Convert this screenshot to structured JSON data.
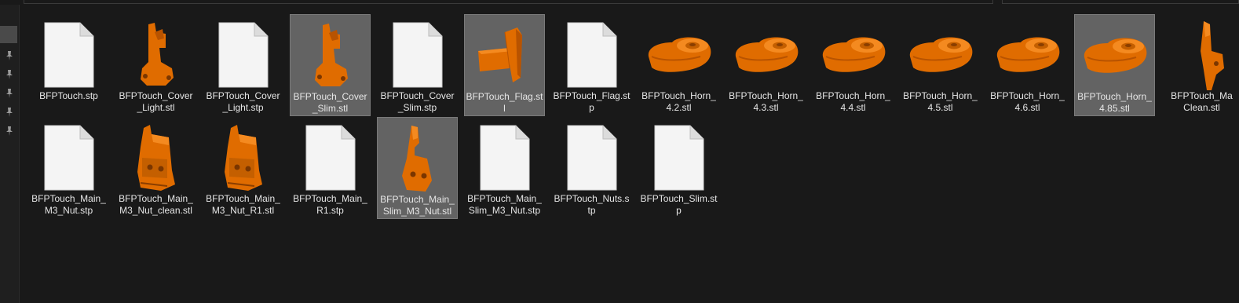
{
  "files": [
    {
      "name": "BFPTouch.stp",
      "label": "BFPTouch.stp",
      "type": "document",
      "selected": false,
      "icon": "document-icon"
    },
    {
      "name": "BFPTouch_Cover_Light.stl",
      "label": "BFPTouch_Cover\n_Light.stl",
      "type": "model-cover",
      "selected": false,
      "icon": "cover-model-thumbnail"
    },
    {
      "name": "BFPTouch_Cover_Light.stp",
      "label": "BFPTouch_Cover\n_Light.stp",
      "type": "document",
      "selected": false,
      "icon": "document-icon"
    },
    {
      "name": "BFPTouch_Cover_Slim.stl",
      "label": "BFPTouch_Cover\n_Slim.stl",
      "type": "model-cover",
      "selected": true,
      "icon": "cover-model-thumbnail"
    },
    {
      "name": "BFPTouch_Cover_Slim.stp",
      "label": "BFPTouch_Cover\n_Slim.stp",
      "type": "document",
      "selected": false,
      "icon": "document-icon"
    },
    {
      "name": "BFPTouch_Flag.stl",
      "label": "BFPTouch_Flag.st\nl",
      "type": "model-flag",
      "selected": true,
      "icon": "flag-model-thumbnail"
    },
    {
      "name": "BFPTouch_Flag.stp",
      "label": "BFPTouch_Flag.st\np",
      "type": "document",
      "selected": false,
      "icon": "document-icon"
    },
    {
      "name": "BFPTouch_Horn_4.2.stl",
      "label": "BFPTouch_Horn_\n4.2.stl",
      "type": "model-horn",
      "selected": false,
      "icon": "horn-model-thumbnail"
    },
    {
      "name": "BFPTouch_Horn_4.3.stl",
      "label": "BFPTouch_Horn_\n4.3.stl",
      "type": "model-horn",
      "selected": false,
      "icon": "horn-model-thumbnail"
    },
    {
      "name": "BFPTouch_Horn_4.4.stl",
      "label": "BFPTouch_Horn_\n4.4.stl",
      "type": "model-horn",
      "selected": false,
      "icon": "horn-model-thumbnail"
    },
    {
      "name": "BFPTouch_Horn_4.5.stl",
      "label": "BFPTouch_Horn_\n4.5.stl",
      "type": "model-horn",
      "selected": false,
      "icon": "horn-model-thumbnail"
    },
    {
      "name": "BFPTouch_Horn_4.6.stl",
      "label": "BFPTouch_Horn_\n4.6.stl",
      "type": "model-horn",
      "selected": false,
      "icon": "horn-model-thumbnail"
    },
    {
      "name": "BFPTouch_Horn_4.85.stl",
      "label": "BFPTouch_Horn_\n4.85.stl",
      "type": "model-horn",
      "selected": true,
      "icon": "horn-model-thumbnail"
    },
    {
      "name": "BFPTouch_Main_Clean.stl",
      "label": "BFPTouch_Ma\nClean.stl",
      "type": "model-main-partial",
      "selected": false,
      "icon": "main-model-thumbnail"
    },
    {
      "name": "BFPTouch_Main_M3_Nut.stp",
      "label": "BFPTouch_Main_\nM3_Nut.stp",
      "type": "document",
      "selected": false,
      "icon": "document-icon"
    },
    {
      "name": "BFPTouch_Main_M3_Nut_clean.stl",
      "label": "BFPTouch_Main_\nM3_Nut_clean.stl",
      "type": "model-main",
      "selected": false,
      "icon": "main-model-thumbnail"
    },
    {
      "name": "BFPTouch_Main_M3_Nut_R1.stl",
      "label": "BFPTouch_Main_\nM3_Nut_R1.stl",
      "type": "model-main",
      "selected": false,
      "icon": "main-model-thumbnail"
    },
    {
      "name": "BFPTouch_Main_R1.stp",
      "label": "BFPTouch_Main_\nR1.stp",
      "type": "document",
      "selected": false,
      "icon": "document-icon"
    },
    {
      "name": "BFPTouch_Main_Slim_M3_Nut.stl",
      "label": "BFPTouch_Main_\nSlim_M3_Nut.stl",
      "type": "model-main-slim",
      "selected": true,
      "icon": "main-slim-model-thumbnail"
    },
    {
      "name": "BFPTouch_Main_Slim_M3_Nut.stp",
      "label": "BFPTouch_Main_\nSlim_M3_Nut.stp",
      "type": "document",
      "selected": false,
      "icon": "document-icon"
    },
    {
      "name": "BFPTouch_Nuts.stp",
      "label": "BFPTouch_Nuts.s\ntp",
      "type": "document",
      "selected": false,
      "icon": "document-icon"
    },
    {
      "name": "BFPTouch_Slim.stp",
      "label": "BFPTouch_Slim.st\np",
      "type": "document",
      "selected": false,
      "icon": "document-icon"
    }
  ],
  "colors": {
    "background": "#191919",
    "selection": "#636363",
    "model": "#e06c00",
    "text": "#e6e6e6"
  }
}
